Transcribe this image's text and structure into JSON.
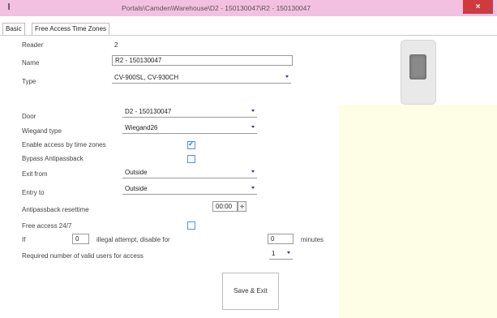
{
  "window": {
    "title": "Portals\\Camden\\Warehouse\\D2 - 150130047\\R2 - 150130047",
    "close_glyph": "×"
  },
  "tabs": [
    {
      "label": "Basic"
    },
    {
      "label": "Free Access Time Zones"
    }
  ],
  "form": {
    "reader_label": "Reader",
    "reader_value": "2",
    "name_label": "Name",
    "name_value": "R2 - 150130047",
    "type_label": "Type",
    "type_value": "CV-900SL, CV-930CH",
    "door_label": "Door",
    "door_value": "D2 - 150130047",
    "wiegand_label": "Wiegand type",
    "wiegand_value": "Wiegand26",
    "enable_tz_label": "Enable access by time zones",
    "enable_tz_checked": true,
    "bypass_label": "Bypass Antipassback",
    "bypass_checked": false,
    "exit_from_label": "Exit from",
    "exit_from_value": "Outside",
    "entry_to_label": "Entry to",
    "entry_to_value": "Outside",
    "apb_reset_label": "Antipassback resettime",
    "apb_reset_value": "00:00",
    "free_access_label": "Free access 24/7",
    "free_access_checked": false,
    "if_label": "If",
    "illegal_count": "0",
    "illegal_label": "illegal attempt, disable for",
    "disable_minutes": "0",
    "minutes_label": "minutes",
    "required_users_label": "Required number of valid users for access",
    "required_users_value": "1"
  },
  "actions": {
    "save_exit_label": "Save & Exit"
  },
  "colors": {
    "titlebar": "#f3c0e2",
    "close": "#cf3a3f",
    "info_panel": "#fefde6",
    "checkbox": "#5b8fd6"
  }
}
